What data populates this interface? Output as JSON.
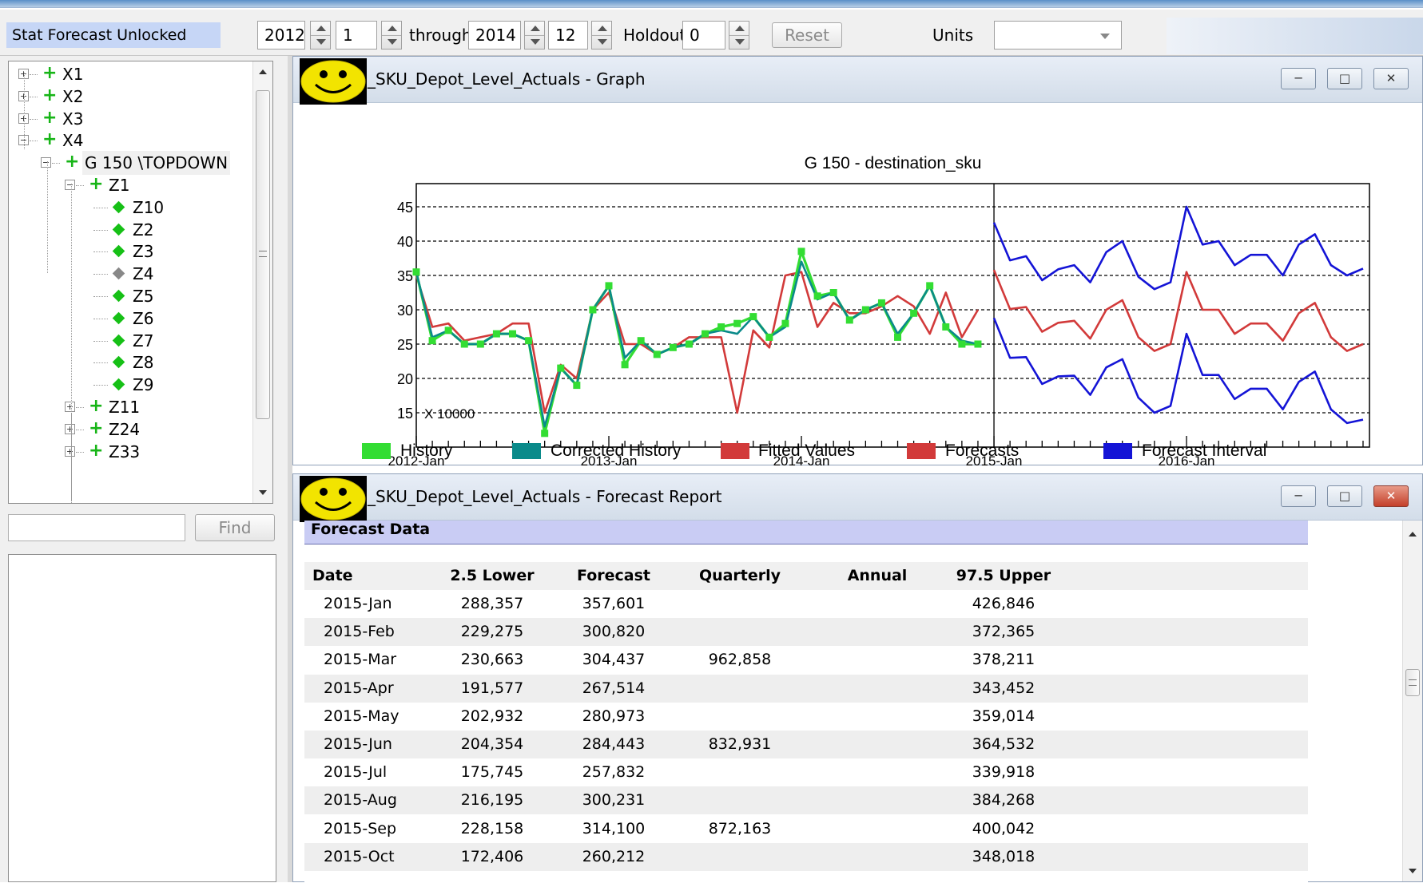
{
  "toolbar": {
    "status": "Stat Forecast Unlocked",
    "start_year": "2012",
    "start_month": "1",
    "through_label": "through",
    "end_year": "2014",
    "end_month": "12",
    "holdout_label": "Holdout",
    "holdout_value": "0",
    "reset_label": "Reset",
    "units_label": "Units",
    "units_value": ""
  },
  "tree": {
    "items": [
      {
        "label": "X1",
        "level": 0,
        "expander": "+",
        "marker": "plus"
      },
      {
        "label": "X2",
        "level": 0,
        "expander": "+",
        "marker": "plus"
      },
      {
        "label": "X3",
        "level": 0,
        "expander": "+",
        "marker": "plus"
      },
      {
        "label": "X4",
        "level": 0,
        "expander": "-",
        "marker": "plus"
      },
      {
        "label": "G 150 \\TOPDOWN",
        "level": 1,
        "expander": "-",
        "marker": "plus",
        "selected": true
      },
      {
        "label": "Z1",
        "level": 2,
        "expander": "-",
        "marker": "plus"
      },
      {
        "label": "Z10",
        "level": 3,
        "expander": "",
        "marker": "diamond"
      },
      {
        "label": "Z2",
        "level": 3,
        "expander": "",
        "marker": "diamond"
      },
      {
        "label": "Z3",
        "level": 3,
        "expander": "",
        "marker": "diamond"
      },
      {
        "label": "Z4",
        "level": 3,
        "expander": "",
        "marker": "diamond-gray"
      },
      {
        "label": "Z5",
        "level": 3,
        "expander": "",
        "marker": "diamond"
      },
      {
        "label": "Z6",
        "level": 3,
        "expander": "",
        "marker": "diamond"
      },
      {
        "label": "Z7",
        "level": 3,
        "expander": "",
        "marker": "diamond"
      },
      {
        "label": "Z8",
        "level": 3,
        "expander": "",
        "marker": "diamond"
      },
      {
        "label": "Z9",
        "level": 3,
        "expander": "",
        "marker": "diamond"
      },
      {
        "label": "Z11",
        "level": 2,
        "expander": "+",
        "marker": "plus"
      },
      {
        "label": "Z24",
        "level": 2,
        "expander": "+",
        "marker": "plus"
      },
      {
        "label": "Z33",
        "level": 2,
        "expander": "+",
        "marker": "plus"
      }
    ]
  },
  "find": {
    "input_value": "",
    "button_label": "Find"
  },
  "graph_window": {
    "title": "_SKU_Depot_Level_Actuals - Graph"
  },
  "report_window": {
    "title": "_SKU_Depot_Level_Actuals - Forecast Report"
  },
  "chart_data": {
    "type": "line",
    "title": "G 150 - destination_sku",
    "scale_note": "X 10000",
    "x": [
      "2012-Jan",
      "2012-Feb",
      "2012-Mar",
      "2012-Apr",
      "2012-May",
      "2012-Jun",
      "2012-Jul",
      "2012-Aug",
      "2012-Sep",
      "2012-Oct",
      "2012-Nov",
      "2012-Dec",
      "2013-Jan",
      "2013-Feb",
      "2013-Mar",
      "2013-Apr",
      "2013-May",
      "2013-Jun",
      "2013-Jul",
      "2013-Aug",
      "2013-Sep",
      "2013-Oct",
      "2013-Nov",
      "2013-Dec",
      "2014-Jan",
      "2014-Feb",
      "2014-Mar",
      "2014-Apr",
      "2014-May",
      "2014-Jun",
      "2014-Jul",
      "2014-Aug",
      "2014-Sep",
      "2014-Oct",
      "2014-Nov",
      "2014-Dec",
      "2015-Jan",
      "2015-Feb",
      "2015-Mar",
      "2015-Apr",
      "2015-May",
      "2015-Jun",
      "2015-Jul",
      "2015-Aug",
      "2015-Sep",
      "2015-Oct",
      "2015-Nov",
      "2015-Dec",
      "2016-Jan",
      "2016-Feb",
      "2016-Mar",
      "2016-Apr",
      "2016-May",
      "2016-Jun",
      "2016-Jul",
      "2016-Aug",
      "2016-Sep",
      "2016-Oct",
      "2016-Nov",
      "2016-Dec"
    ],
    "x_ticks": [
      "2012-Jan",
      "2013-Jan",
      "2014-Jan",
      "2015-Jan",
      "2016-Jan"
    ],
    "ylim": [
      10,
      45
    ],
    "y_ticks": [
      15,
      20,
      25,
      30,
      35,
      40,
      45
    ],
    "grid": true,
    "legend": "bottom",
    "series": [
      {
        "name": "History",
        "color": "#33dd33",
        "x_start": 0,
        "markers": true,
        "values": [
          35.5,
          25.5,
          27,
          25,
          25,
          26.5,
          26.5,
          25.5,
          12,
          21.5,
          19,
          30,
          33.5,
          22,
          25.5,
          23.5,
          24.5,
          25,
          26.5,
          27.5,
          28,
          29,
          26,
          28,
          38.5,
          32,
          32.5,
          28.5,
          30,
          31,
          26,
          29.5,
          33.5,
          27.5,
          25,
          25
        ]
      },
      {
        "name": "Corrected History",
        "color": "#0a8a8a",
        "x_start": 0,
        "markers": false,
        "values": [
          35.5,
          26,
          27,
          25,
          25,
          26.5,
          26.5,
          25.5,
          13,
          21.5,
          19,
          30,
          33.5,
          23,
          25.5,
          23.5,
          24.5,
          25,
          26.5,
          27,
          26.5,
          29,
          26,
          27.5,
          37,
          31.5,
          32.5,
          28.5,
          30,
          31,
          26.5,
          29.5,
          33.5,
          27.5,
          25.5,
          25
        ]
      },
      {
        "name": "Fitted Values",
        "color": "#d23a3a",
        "x_start": 0,
        "markers": false,
        "values": [
          35,
          27.5,
          28,
          25.5,
          26,
          26.5,
          28,
          28,
          15,
          22,
          20,
          30,
          32.5,
          25,
          25,
          23.5,
          24.5,
          26,
          26,
          26,
          15,
          27,
          24.5,
          35,
          35.5,
          27.5,
          31,
          29.5,
          29.5,
          30.5,
          32,
          30.5,
          26.5,
          32.5,
          26,
          30
        ]
      },
      {
        "name": "Forecasts",
        "color": "#d23a3a",
        "x_start": 36,
        "values": [
          35.8,
          30.1,
          30.4,
          26.8,
          28.1,
          28.4,
          25.8,
          30.0,
          31.4,
          26.0,
          24.0,
          25.0,
          35.5,
          30.0,
          30.0,
          26.5,
          28.0,
          28.0,
          25.5,
          29.5,
          31.0,
          26.0,
          24.0,
          25.0
        ]
      },
      {
        "name": "Forecast Interval",
        "color": "#1414d6",
        "x_start": 36,
        "upper": [
          42.7,
          37.2,
          37.8,
          34.3,
          35.9,
          36.5,
          34.0,
          38.4,
          40.0,
          34.8,
          33.0,
          34.0,
          45.0,
          39.5,
          40.0,
          36.5,
          38.0,
          38.0,
          35.0,
          39.5,
          41.0,
          36.5,
          35.0,
          36.0
        ],
        "lower": [
          28.8,
          23.0,
          23.1,
          19.2,
          20.3,
          20.4,
          17.6,
          21.6,
          22.8,
          17.2,
          15.0,
          16.0,
          26.5,
          20.5,
          20.5,
          17.0,
          18.5,
          18.5,
          15.5,
          19.5,
          21.0,
          15.5,
          13.5,
          14.0
        ]
      }
    ]
  },
  "report": {
    "section_title": "Forecast Data",
    "columns": [
      "Date",
      "2.5 Lower",
      "Forecast",
      "Quarterly",
      "Annual",
      "97.5 Upper"
    ],
    "rows": [
      [
        "2015-Jan",
        "288,357",
        "357,601",
        "",
        "",
        "426,846"
      ],
      [
        "2015-Feb",
        "229,275",
        "300,820",
        "",
        "",
        "372,365"
      ],
      [
        "2015-Mar",
        "230,663",
        "304,437",
        "962,858",
        "",
        "378,211"
      ],
      [
        "2015-Apr",
        "191,577",
        "267,514",
        "",
        "",
        "343,452"
      ],
      [
        "2015-May",
        "202,932",
        "280,973",
        "",
        "",
        "359,014"
      ],
      [
        "2015-Jun",
        "204,354",
        "284,443",
        "832,931",
        "",
        "364,532"
      ],
      [
        "2015-Jul",
        "175,745",
        "257,832",
        "",
        "",
        "339,918"
      ],
      [
        "2015-Aug",
        "216,195",
        "300,231",
        "",
        "",
        "384,268"
      ],
      [
        "2015-Sep",
        "228,158",
        "314,100",
        "872,163",
        "",
        "400,042"
      ],
      [
        "2015-Oct",
        "172,406",
        "260,212",
        "",
        "",
        "348,018"
      ]
    ]
  }
}
